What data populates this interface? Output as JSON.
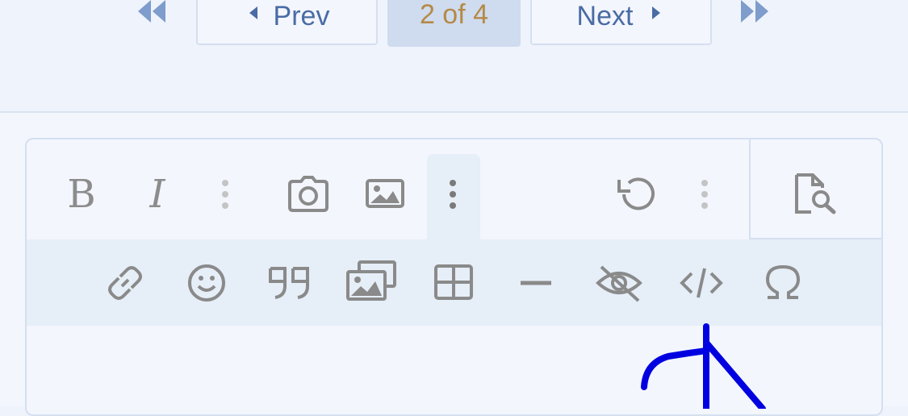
{
  "pagination": {
    "prev_label": "Prev",
    "current_label": "2 of 4",
    "next_label": "Next",
    "icons": [
      "first-page-icon",
      "prev-arrow-icon",
      "next-arrow-icon",
      "last-page-icon"
    ]
  },
  "toolbar": {
    "row1": [
      "bold-icon",
      "italic-icon",
      "more-text-options-icon",
      "camera-icon",
      "image-icon",
      "more-insert-options-icon",
      "undo-icon",
      "more-options-icon",
      "preview-icon"
    ],
    "row2": [
      "link-icon",
      "emoji-icon",
      "quote-icon",
      "gallery-icon",
      "table-icon",
      "horizontal-line-icon",
      "spoiler-icon",
      "code-icon",
      "special-character-icon"
    ],
    "bold_glyph": "B",
    "italic_glyph": "I"
  },
  "colors": {
    "accent": "#4a6ba5",
    "current_page_text": "#b48a47",
    "icon": "#8a8a8a",
    "annotation_ink": "#0000e0"
  }
}
